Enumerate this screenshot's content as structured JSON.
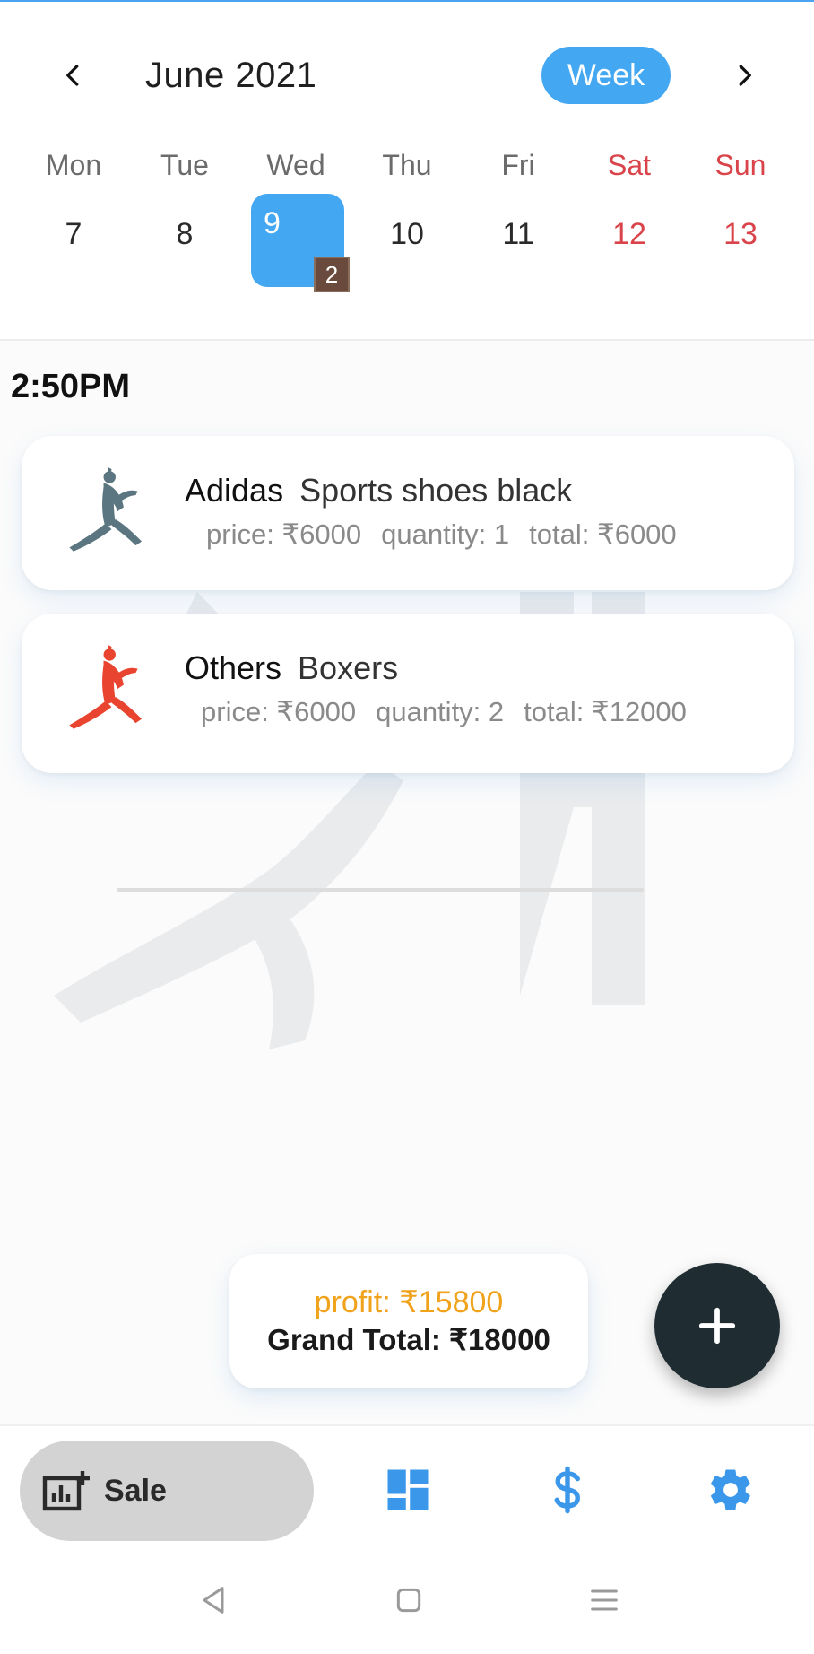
{
  "calendar": {
    "month_label": "June 2021",
    "view_mode_label": "Week",
    "prev_icon": "chevron-left-icon",
    "next_icon": "chevron-right-icon",
    "day_names": [
      "Mon",
      "Tue",
      "Wed",
      "Thu",
      "Fri",
      "Sat",
      "Sun"
    ],
    "day_numbers": [
      "7",
      "8",
      "9",
      "10",
      "11",
      "12",
      "13"
    ],
    "selected_day": "9",
    "selected_day_badge": "2",
    "weekend_color": "#d9444a",
    "accent_color": "#44a7f2"
  },
  "entries": {
    "time_label": "2:50PM",
    "items": [
      {
        "brand": "Adidas",
        "product": "Sports shoes black",
        "price": "price: ₹6000",
        "quantity": "quantity: 1",
        "total": "total: ₹6000",
        "icon": "athlete-silhouette-icon",
        "icon_color": "#5b7680"
      },
      {
        "brand": "Others",
        "product": "Boxers",
        "price": "price: ₹6000",
        "quantity": "quantity: 2",
        "total": "total: ₹12000",
        "icon": "athlete-silhouette-icon",
        "icon_color": "#e9442f"
      }
    ]
  },
  "summary": {
    "profit": "profit: ₹15800",
    "grand_total": "Grand Total: ₹18000",
    "profit_color": "#f0a21b"
  },
  "fab": {
    "icon": "plus-icon",
    "color": "#1f2d33"
  },
  "bottom_nav": {
    "sale_label": "Sale",
    "sale_icon": "add-chart-icon",
    "dashboard_icon": "dashboard-icon",
    "dollar_icon": "dollar-icon",
    "settings_icon": "gear-icon"
  },
  "system_nav": {
    "back_icon": "back-triangle-icon",
    "home_icon": "home-square-icon",
    "menu_icon": "menu-lines-icon"
  }
}
